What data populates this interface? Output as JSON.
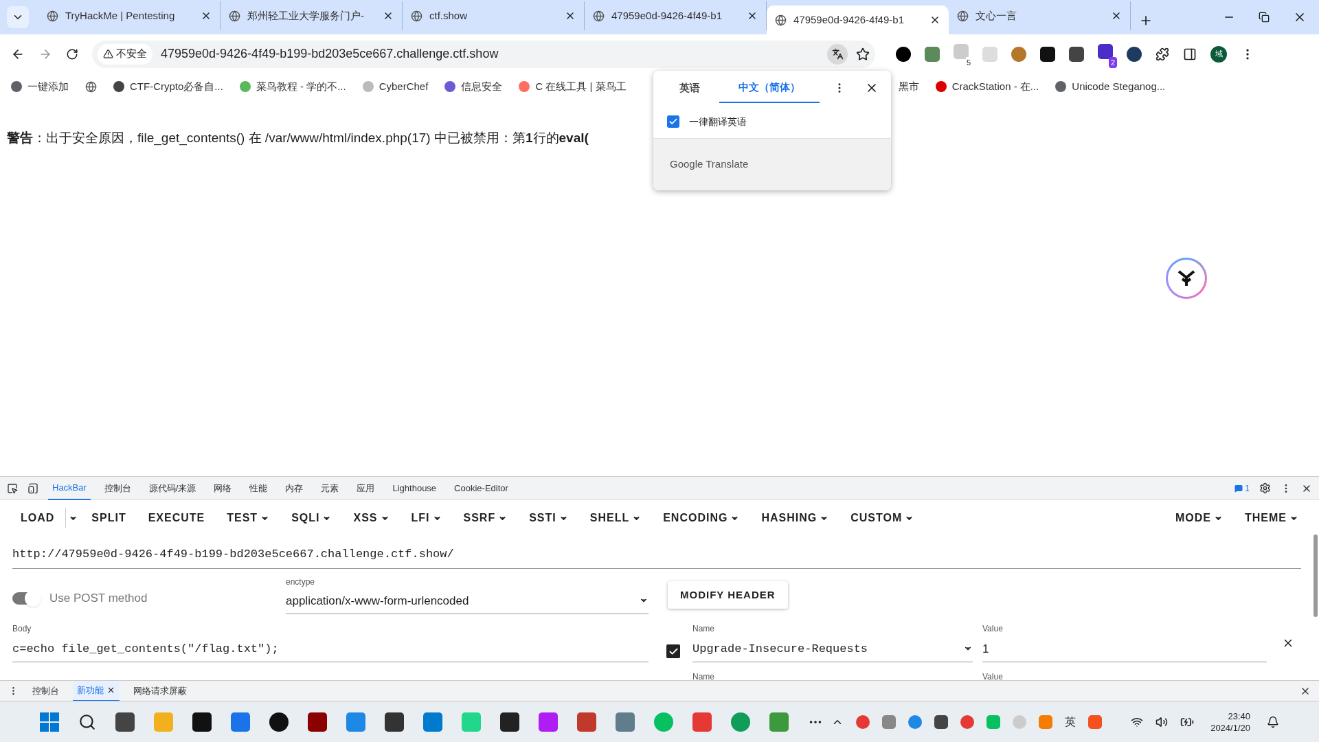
{
  "browser": {
    "tabs": [
      {
        "title": "TryHackMe | Pentesting",
        "selected": false
      },
      {
        "title": "郑州轻工业大学服务门户-",
        "selected": false
      },
      {
        "title": "ctf.show",
        "selected": false
      },
      {
        "title": "47959e0d-9426-4f49-b1",
        "selected": false
      },
      {
        "title": "47959e0d-9426-4f49-b1",
        "selected": true
      },
      {
        "title": "文心一言",
        "selected": false
      }
    ],
    "address": {
      "security": "不安全",
      "url": "47959e0d-9426-4f49-b199-bd203e5ce667.challenge.ctf.show"
    },
    "extension_badges": [
      "5",
      "2"
    ],
    "profile_initial": "域",
    "bookmarks": [
      {
        "label": "一键添加"
      },
      {
        "kind": "icon"
      },
      {
        "label": "CTF-Crypto必备自..."
      },
      {
        "label": "菜鸟教程 - 学的不..."
      },
      {
        "label": "CyberChef"
      },
      {
        "label": "信息安全"
      },
      {
        "label": "C 在线工具 | 菜鸟工"
      },
      {
        "label": "黑市"
      },
      {
        "label": "CrackStation - 在..."
      },
      {
        "label": "Unicode Steganog..."
      }
    ]
  },
  "page": {
    "warning": "**警告**：出于安全原因，file_get_contents() 在 /var/www/html/index.php(17) 中已被禁用：第**1**行的**eval(**"
  },
  "translate_popup": {
    "tabs": [
      {
        "label": "英语",
        "selected": false
      },
      {
        "label": "中文（简体）",
        "selected": true
      }
    ],
    "option": {
      "label": "一律翻译英语",
      "checked": true
    },
    "footer": "Google Translate"
  },
  "devtools": {
    "tabs": [
      {
        "label": "HackBar",
        "selected": true
      },
      {
        "label": "控制台",
        "selected": false
      },
      {
        "label": "源代码/来源",
        "selected": false
      },
      {
        "label": "网络",
        "selected": false
      },
      {
        "label": "性能",
        "selected": false
      },
      {
        "label": "内存",
        "selected": false
      },
      {
        "label": "元素",
        "selected": false
      },
      {
        "label": "应用",
        "selected": false
      },
      {
        "label": "Lighthouse",
        "selected": false
      },
      {
        "label": "Cookie-Editor",
        "selected": false
      }
    ],
    "issues_count": "1",
    "hackbar": {
      "menu": [
        {
          "label": "LOAD",
          "dropdown": false
        },
        {
          "label": "SPLIT",
          "dropdown": false
        },
        {
          "label": "EXECUTE",
          "dropdown": false
        },
        {
          "label": "TEST",
          "dropdown": true
        },
        {
          "label": "SQLI",
          "dropdown": true
        },
        {
          "label": "XSS",
          "dropdown": true
        },
        {
          "label": "LFI",
          "dropdown": true
        },
        {
          "label": "SSRF",
          "dropdown": true
        },
        {
          "label": "SSTI",
          "dropdown": true
        },
        {
          "label": "SHELL",
          "dropdown": true
        },
        {
          "label": "ENCODING",
          "dropdown": true
        },
        {
          "label": "HASHING",
          "dropdown": true
        },
        {
          "label": "CUSTOM",
          "dropdown": true
        }
      ],
      "right_menu": [
        {
          "label": "MODE"
        },
        {
          "label": "THEME"
        }
      ],
      "url": "http://47959e0d-9426-4f49-b199-bd203e5ce667.challenge.ctf.show/",
      "post": {
        "label": "Use POST method",
        "on": true
      },
      "enctype": {
        "label": "enctype",
        "value": "application/x-www-form-urlencoded"
      },
      "modify_header": "MODIFY HEADER",
      "body": {
        "label": "Body",
        "value": "c=echo file_get_contents(\"/flag.txt\");"
      },
      "headers": [
        {
          "checked": true,
          "name_label": "Name",
          "name": "Upgrade-Insecure-Requests",
          "value_label": "Value",
          "value": "1"
        },
        {
          "name_label": "Name",
          "value_label": "Value"
        }
      ]
    },
    "drawer_tabs": [
      {
        "label": "控制台",
        "selected": false
      },
      {
        "label": "新功能",
        "selected": true
      },
      {
        "label": "网络请求屏蔽",
        "selected": false
      }
    ]
  },
  "taskbar": {
    "input_method": "英",
    "time": "23:40",
    "date": "2024/1/20"
  }
}
